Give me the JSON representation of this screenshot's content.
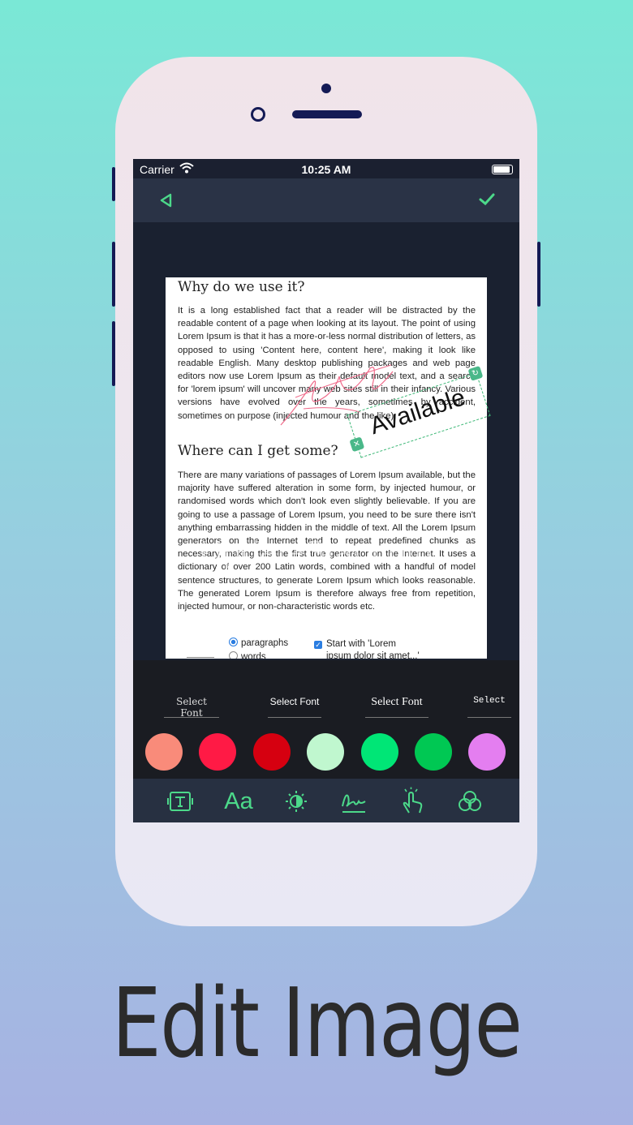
{
  "status": {
    "carrier": "Carrier",
    "time": "10:25 AM"
  },
  "doc": {
    "heading1": "Why do we use it?",
    "para1": "It is a long established fact that a reader will be distracted by the readable content of a page when looking at its layout. The point of using Lorem Ipsum is that it has a more-or-less normal distribution of letters, as opposed to using 'Content here, content here', making it look like readable English. Many desktop publishing packages and web page editors now use Lorem Ipsum as their default model text, and a search for 'lorem ipsum' will uncover many web sites still in their infancy. Various versions have evolved over the years, sometimes by accident, sometimes on purpose (injected humour and the like).",
    "heading2": "Where can I get some?",
    "para2": "There are many variations of passages of Lorem Ipsum available, but the majority have suffered alteration in some form, by injected humour, or randomised words which don't look even slightly believable. If you are going to use a passage of Lorem Ipsum, you need to be sure there isn't anything embarrassing hidden in the middle of text. All the Lorem Ipsum generators on the Internet tend to repeat predefined chunks as necessary, making this the first true generator on the Internet. It uses a dictionary of over 200 Latin words, combined with a handful of model sentence structures, to generate Lorem Ipsum which looks reasonable. The generated Lorem Ipsum is therefore always free from repetition, injected humour, or non-characteristic words etc.",
    "radio_paragraphs": "paragraphs",
    "radio_words": "words",
    "checkbox_label": "Start with 'Lorem",
    "checkbox_label2": "ipsum dolor sit amet...'"
  },
  "stamp": {
    "text": "Available"
  },
  "watermark": "UpdateStar.com",
  "fonts": [
    "Select Font",
    "Select Font",
    "Select Font",
    "Select"
  ],
  "colors": [
    "#f98b7a",
    "#ff1a45",
    "#d60010",
    "#c0f7cf",
    "#00e676",
    "#00c853",
    "#e47ef0"
  ],
  "accent": "#4cd98a",
  "tools": [
    "text-box-icon",
    "font-size-icon",
    "brightness-icon",
    "signature-icon",
    "touch-icon",
    "color-filter-icon"
  ],
  "footer_title": "Edit Image"
}
